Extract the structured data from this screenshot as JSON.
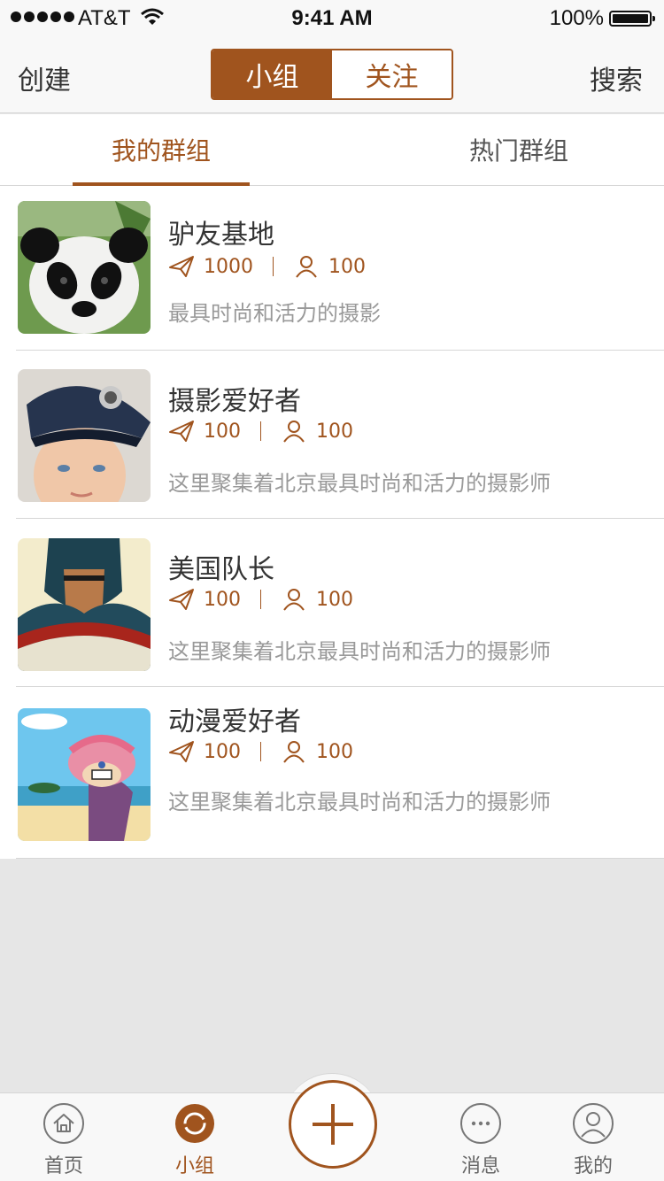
{
  "status_bar": {
    "carrier": "AT&T",
    "time": "9:41 AM",
    "battery_pct": "100%"
  },
  "nav": {
    "left_label": "创建",
    "right_label": "搜索",
    "segments": [
      "小组",
      "关注"
    ],
    "active_segment": "小组"
  },
  "tabs": [
    {
      "label": "我的群组"
    },
    {
      "label": "热门群组"
    }
  ],
  "groups": [
    {
      "name": "驴友基地",
      "posts": "1000",
      "members": "100",
      "desc": "最具时尚和活力的摄影",
      "avatar": "panda"
    },
    {
      "name": "摄影爱好者",
      "posts": "100",
      "members": "100",
      "desc": "这里聚集着北京最具时尚和活力的摄影师",
      "avatar": "boy-in-cap"
    },
    {
      "name": "美国队长",
      "posts": "100",
      "members": "100",
      "desc": "这里聚集着北京最具时尚和活力的摄影师",
      "avatar": "captain-america"
    },
    {
      "name": "动漫爱好者",
      "posts": "100",
      "members": "100",
      "desc": "这里聚集着北京最具时尚和活力的摄影师",
      "avatar": "anime-reindeer"
    }
  ],
  "tabbar": {
    "items": [
      {
        "label": "首页",
        "icon": "home-icon"
      },
      {
        "label": "小组",
        "icon": "group-icon"
      },
      {
        "label": "消息",
        "icon": "message-icon"
      },
      {
        "label": "我的",
        "icon": "profile-icon"
      }
    ],
    "center_icon": "plus-icon",
    "active": "小组"
  },
  "colors": {
    "accent": "#a0541e",
    "background": "#e6e6e6",
    "muted_text": "#999999"
  }
}
